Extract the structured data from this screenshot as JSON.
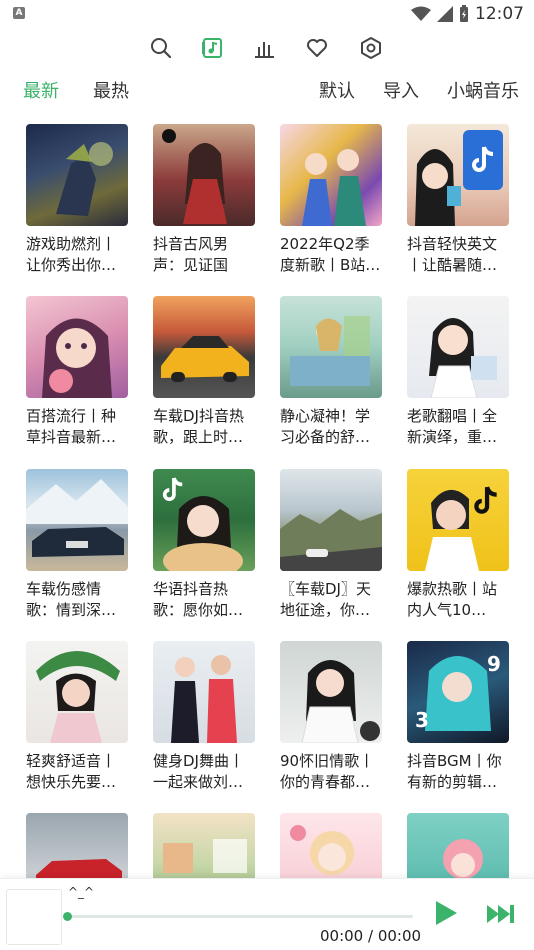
{
  "status_bar": {
    "time": "12:07"
  },
  "toolbar": {
    "icons": [
      "search-icon",
      "music-note-icon",
      "chart-icon",
      "heart-icon",
      "settings-icon"
    ],
    "active_color": "#3bb36b"
  },
  "tabs": {
    "left": [
      {
        "label": "最新",
        "active": true
      },
      {
        "label": "最热",
        "active": false
      }
    ],
    "right": [
      {
        "label": "默认"
      },
      {
        "label": "导入"
      },
      {
        "label": "小蜗音乐"
      }
    ]
  },
  "playlists": [
    {
      "title": "游戏助燃剂丨让你秀出你…"
    },
    {
      "title": "抖音古风男声：见证国风…"
    },
    {
      "title": "2022年Q2季度新歌丨B站…"
    },
    {
      "title": "抖音轻快英文丨让酷暑随…"
    },
    {
      "title": "百搭流行丨种草抖音最新…"
    },
    {
      "title": "车载DJ抖音热歌，跟上时…"
    },
    {
      "title": "静心凝神！学习必备的舒…"
    },
    {
      "title": "老歌翻唱丨全新演绎，重…"
    },
    {
      "title": "车载伤感情歌：情到深…"
    },
    {
      "title": "华语抖音热歌：愿你如…"
    },
    {
      "title": "〖车载DJ〗天地征途，你…"
    },
    {
      "title": "爆款热歌丨站内人气10…"
    },
    {
      "title": "轻爽舒适音丨想快乐先要…"
    },
    {
      "title": "健身DJ舞曲丨一起来做刘…"
    },
    {
      "title": "90怀旧情歌丨你的青春都…"
    },
    {
      "title": "抖音BGM丨你有新的剪辑…"
    },
    {
      "title": ""
    },
    {
      "title": ""
    },
    {
      "title": ""
    },
    {
      "title": ""
    }
  ],
  "player": {
    "song": "^_^",
    "time": "00:00 / 00:00",
    "progress": 0,
    "accent_color": "#3bb36b"
  }
}
